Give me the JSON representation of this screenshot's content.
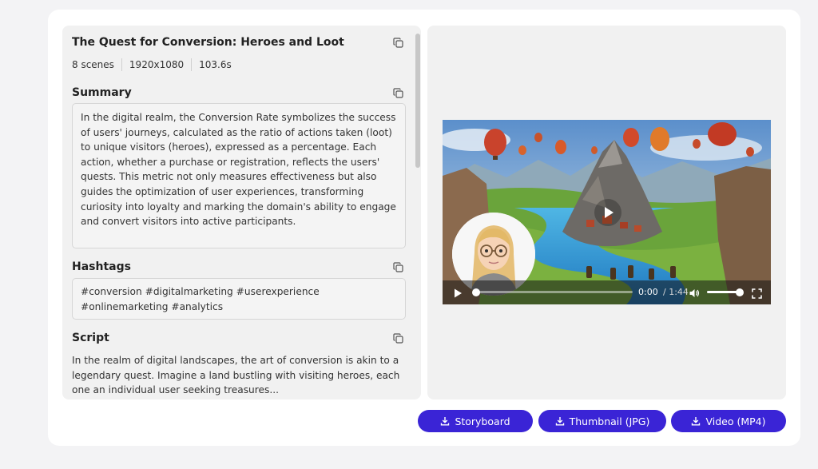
{
  "details": {
    "title": "The Quest for Conversion: Heroes and Loot",
    "scenes": "8 scenes",
    "resolution": "1920x1080",
    "duration": "103.6s"
  },
  "summary": {
    "heading": "Summary",
    "text": "In the digital realm, the Conversion Rate symbolizes the success of users' journeys, calculated as the ratio of actions taken (loot) to unique visitors (heroes), expressed as a percentage. Each action, whether a purchase or registration, reflects the users' quests. This metric not only measures effectiveness but also guides the optimization of user experiences, transforming curiosity into loyalty and marking the domain's ability to engage and convert visitors into active participants."
  },
  "hashtags": {
    "heading": "Hashtags",
    "text": "#conversion #digitalmarketing #userexperience #onlinemarketing #analytics"
  },
  "script": {
    "heading": "Script",
    "text": "In the realm of digital landscapes, the art of conversion is akin to a legendary quest. Imagine a land bustling with visiting heroes, each one an individual user seeking treasures..."
  },
  "player": {
    "time_current": "0:00",
    "time_total": "/ 1:44",
    "progress": 0,
    "volume": 0.85
  },
  "buttons": {
    "storyboard": "Storyboard",
    "thumbnail": "Thumbnail (JPG)",
    "video": "Video (MP4)"
  },
  "colors": {
    "primary": "#3a24d6",
    "panel": "#f1f1f1"
  },
  "icons": {
    "copy": "copy-icon",
    "download": "download-icon",
    "play": "play-icon",
    "volume": "volume-icon",
    "fullscreen": "fullscreen-icon"
  }
}
